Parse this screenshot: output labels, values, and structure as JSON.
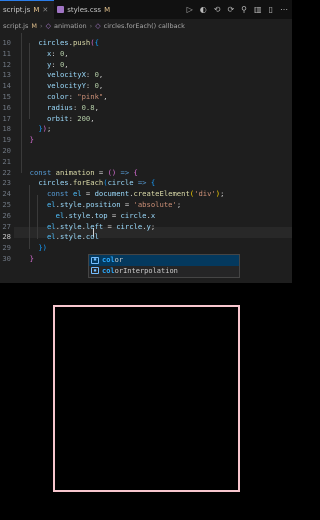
{
  "tabs": [
    {
      "label": "script.js",
      "badge": "M",
      "icon": "JS",
      "active": true
    },
    {
      "label": "styles.css",
      "badge": "M",
      "icon": "css-icon",
      "active": false
    }
  ],
  "breadcrumb": {
    "file": "script.js",
    "badge": "M",
    "path": [
      "animation",
      "circles.forEach() callback"
    ]
  },
  "code_lines": [
    {
      "n": "10",
      "tokens": [
        [
          "    ",
          "t-p"
        ],
        [
          "circles",
          "t-var"
        ],
        [
          ".",
          "t-p"
        ],
        [
          "push",
          "t-fn"
        ],
        [
          "(",
          "t-br"
        ],
        [
          "{",
          "t-br2"
        ]
      ]
    },
    {
      "n": "11",
      "tokens": [
        [
          "      ",
          "t-p"
        ],
        [
          "x",
          "t-var"
        ],
        [
          ": ",
          "t-p"
        ],
        [
          "0",
          "t-num"
        ],
        [
          ",",
          "t-p"
        ]
      ]
    },
    {
      "n": "12",
      "tokens": [
        [
          "      ",
          "t-p"
        ],
        [
          "y",
          "t-var"
        ],
        [
          ": ",
          "t-p"
        ],
        [
          "0",
          "t-num"
        ],
        [
          ",",
          "t-p"
        ]
      ]
    },
    {
      "n": "13",
      "tokens": [
        [
          "      ",
          "t-p"
        ],
        [
          "velocityX",
          "t-var"
        ],
        [
          ": ",
          "t-p"
        ],
        [
          "0",
          "t-num"
        ],
        [
          ",",
          "t-p"
        ]
      ]
    },
    {
      "n": "14",
      "tokens": [
        [
          "      ",
          "t-p"
        ],
        [
          "velocityY",
          "t-var"
        ],
        [
          ": ",
          "t-p"
        ],
        [
          "0",
          "t-num"
        ],
        [
          ",",
          "t-p"
        ]
      ]
    },
    {
      "n": "15",
      "tokens": [
        [
          "      ",
          "t-p"
        ],
        [
          "color",
          "t-var"
        ],
        [
          ": ",
          "t-p"
        ],
        [
          "\"pink\"",
          "t-str"
        ],
        [
          ",",
          "t-p"
        ]
      ]
    },
    {
      "n": "16",
      "tokens": [
        [
          "      ",
          "t-p"
        ],
        [
          "radius",
          "t-var"
        ],
        [
          ": ",
          "t-p"
        ],
        [
          "0.8",
          "t-num"
        ],
        [
          ",",
          "t-p"
        ]
      ]
    },
    {
      "n": "17",
      "tokens": [
        [
          "      ",
          "t-p"
        ],
        [
          "orbit",
          "t-var"
        ],
        [
          ": ",
          "t-p"
        ],
        [
          "200",
          "t-num"
        ],
        [
          ",",
          "t-p"
        ]
      ]
    },
    {
      "n": "18",
      "tokens": [
        [
          "    ",
          "t-p"
        ],
        [
          "}",
          "t-br2"
        ],
        [
          ")",
          "t-br"
        ],
        [
          ";",
          "t-p"
        ]
      ]
    },
    {
      "n": "19",
      "tokens": [
        [
          "  ",
          "t-p"
        ],
        [
          "}",
          "t-br"
        ]
      ]
    },
    {
      "n": "20",
      "tokens": []
    },
    {
      "n": "21",
      "tokens": []
    },
    {
      "n": "22",
      "tokens": [
        [
          "  ",
          "t-p"
        ],
        [
          "const",
          "t-kw"
        ],
        [
          " ",
          "t-p"
        ],
        [
          "animation",
          "t-fn"
        ],
        [
          " = ",
          "t-p"
        ],
        [
          "()",
          "t-br"
        ],
        [
          " ",
          "t-p"
        ],
        [
          "=>",
          "t-kw"
        ],
        [
          " ",
          "t-p"
        ],
        [
          "{",
          "t-br"
        ]
      ]
    },
    {
      "n": "23",
      "tokens": [
        [
          "    ",
          "t-p"
        ],
        [
          "circles",
          "t-var"
        ],
        [
          ".",
          "t-p"
        ],
        [
          "forEach",
          "t-fn"
        ],
        [
          "(",
          "t-br2"
        ],
        [
          "circle",
          "t-var"
        ],
        [
          " ",
          "t-p"
        ],
        [
          "=>",
          "t-kw"
        ],
        [
          " ",
          "t-p"
        ],
        [
          "{",
          "t-br2"
        ]
      ]
    },
    {
      "n": "24",
      "tokens": [
        [
          "      ",
          "t-p"
        ],
        [
          "const",
          "t-kw"
        ],
        [
          " ",
          "t-p"
        ],
        [
          "el",
          "t-const"
        ],
        [
          " = ",
          "t-p"
        ],
        [
          "document",
          "t-var"
        ],
        [
          ".",
          "t-p"
        ],
        [
          "createElement",
          "t-fn"
        ],
        [
          "(",
          "t-cb"
        ],
        [
          "'div'",
          "t-str"
        ],
        [
          ")",
          "t-cb"
        ],
        [
          ";",
          "t-p"
        ]
      ]
    },
    {
      "n": "25",
      "tokens": [
        [
          "      ",
          "t-p"
        ],
        [
          "el",
          "t-const"
        ],
        [
          ".",
          "t-p"
        ],
        [
          "style",
          "t-var"
        ],
        [
          ".",
          "t-p"
        ],
        [
          "position",
          "t-var"
        ],
        [
          " = ",
          "t-p"
        ],
        [
          "'absolute'",
          "t-str"
        ],
        [
          ";",
          "t-p"
        ]
      ]
    },
    {
      "n": "26",
      "tokens": [
        [
          "        ",
          "t-p"
        ],
        [
          "el",
          "t-const"
        ],
        [
          ".",
          "t-p"
        ],
        [
          "style",
          "t-var"
        ],
        [
          ".",
          "t-p"
        ],
        [
          "top",
          "t-var"
        ],
        [
          " = ",
          "t-p"
        ],
        [
          "circle",
          "t-var"
        ],
        [
          ".",
          "t-p"
        ],
        [
          "x",
          "t-var"
        ]
      ]
    },
    {
      "n": "27",
      "tokens": [
        [
          "      ",
          "t-p"
        ],
        [
          "el",
          "t-const"
        ],
        [
          ".",
          "t-p"
        ],
        [
          "style",
          "t-var"
        ],
        [
          ".",
          "t-p"
        ],
        [
          "left",
          "t-var"
        ],
        [
          " = ",
          "t-p"
        ],
        [
          "circle",
          "t-var"
        ],
        [
          ".",
          "t-p"
        ],
        [
          "y",
          "t-var"
        ],
        [
          ";",
          "t-p"
        ]
      ]
    },
    {
      "n": "28",
      "tokens": [
        [
          "      ",
          "t-p"
        ],
        [
          "el",
          "t-const"
        ],
        [
          ".",
          "t-p"
        ],
        [
          "style",
          "t-var"
        ],
        [
          ".",
          "t-p"
        ],
        [
          "col",
          "t-var"
        ]
      ]
    },
    {
      "n": "29",
      "tokens": [
        [
          "    ",
          "t-p"
        ],
        [
          "})",
          "t-br2"
        ]
      ]
    },
    {
      "n": "30",
      "tokens": [
        [
          "  ",
          "t-p"
        ],
        [
          "}",
          "t-br"
        ]
      ]
    }
  ],
  "current_line": "28",
  "suggestions": [
    {
      "match": "col",
      "rest": "or",
      "icon": "property-icon",
      "selected": true
    },
    {
      "match": "col",
      "rest": "orInterpolation",
      "icon": "property-icon",
      "selected": false
    }
  ],
  "colors": {
    "editor_bg": "#1e1e1e",
    "preview_border": "#f7c6ce",
    "accent": "#2b7de9"
  }
}
